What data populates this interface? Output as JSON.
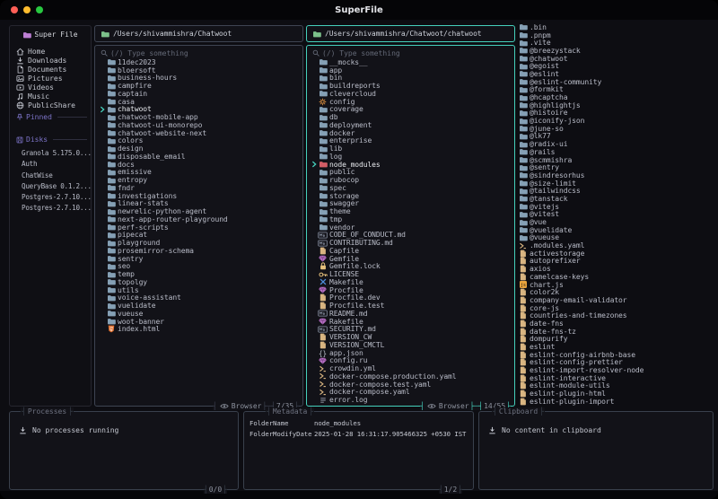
{
  "window": {
    "title": "SuperFile"
  },
  "sidebar": {
    "app_title": "Super File",
    "items": [
      {
        "label": "Home",
        "icon": "home"
      },
      {
        "label": "Downloads",
        "icon": "download"
      },
      {
        "label": "Documents",
        "icon": "document"
      },
      {
        "label": "Pictures",
        "icon": "picture"
      },
      {
        "label": "Videos",
        "icon": "video"
      },
      {
        "label": "Music",
        "icon": "music"
      },
      {
        "label": "PublicShare",
        "icon": "globe"
      }
    ],
    "pinned_label": "Pinned",
    "disks_label": "Disks",
    "disks": [
      "Granola 5.175.0...",
      "Auth",
      "ChatWise",
      "QueryBase 0.1.2...",
      "Postgres-2.7.10...",
      "Postgres-2.7.10..."
    ]
  },
  "panels": [
    {
      "path": "/Users/shivammishra/Chatwoot",
      "search_placeholder": "(/) Type something",
      "footer_mode": "Browser",
      "footer_count": "7/35",
      "active": false,
      "files": [
        {
          "name": "11dec2023",
          "icon": "folder"
        },
        {
          "name": "bloersoft",
          "icon": "folder"
        },
        {
          "name": "business-hours",
          "icon": "folder"
        },
        {
          "name": "campfire",
          "icon": "folder"
        },
        {
          "name": "captain",
          "icon": "folder"
        },
        {
          "name": "casa",
          "icon": "folder"
        },
        {
          "name": "chatwoot",
          "icon": "folder",
          "selected": true
        },
        {
          "name": "chatwoot-mobile-app",
          "icon": "folder"
        },
        {
          "name": "chatwoot-ui-monorepo",
          "icon": "folder"
        },
        {
          "name": "chatwoot-website-next",
          "icon": "folder"
        },
        {
          "name": "colors",
          "icon": "folder"
        },
        {
          "name": "design",
          "icon": "folder"
        },
        {
          "name": "disposable_email",
          "icon": "folder"
        },
        {
          "name": "docs",
          "icon": "folder"
        },
        {
          "name": "emissive",
          "icon": "folder"
        },
        {
          "name": "entropy",
          "icon": "folder"
        },
        {
          "name": "fndr",
          "icon": "folder"
        },
        {
          "name": "investigations",
          "icon": "folder"
        },
        {
          "name": "linear-stats",
          "icon": "folder"
        },
        {
          "name": "newrelic-python-agent",
          "icon": "folder"
        },
        {
          "name": "next-app-router-playground",
          "icon": "folder"
        },
        {
          "name": "perf-scripts",
          "icon": "folder"
        },
        {
          "name": "pipecat",
          "icon": "folder"
        },
        {
          "name": "playground",
          "icon": "folder"
        },
        {
          "name": "prosemirror-schema",
          "icon": "folder"
        },
        {
          "name": "sentry",
          "icon": "folder"
        },
        {
          "name": "seo",
          "icon": "folder"
        },
        {
          "name": "temp",
          "icon": "folder"
        },
        {
          "name": "topolgy",
          "icon": "folder"
        },
        {
          "name": "utils",
          "icon": "folder"
        },
        {
          "name": "voice-assistant",
          "icon": "folder"
        },
        {
          "name": "vuelidate",
          "icon": "folder"
        },
        {
          "name": "vueuse",
          "icon": "folder"
        },
        {
          "name": "woot-banner",
          "icon": "folder"
        },
        {
          "name": "index.html",
          "icon": "html"
        }
      ]
    },
    {
      "path": "/Users/shivammishra/Chatwoot/chatwoot",
      "search_placeholder": "(/) Type something",
      "footer_mode": "Browser",
      "footer_count": "14/55",
      "active": true,
      "files": [
        {
          "name": "__mocks__",
          "icon": "folder"
        },
        {
          "name": "app",
          "icon": "folder"
        },
        {
          "name": "bin",
          "icon": "folder"
        },
        {
          "name": "buildreports",
          "icon": "folder"
        },
        {
          "name": "clevercloud",
          "icon": "folder"
        },
        {
          "name": "config",
          "icon": "gear"
        },
        {
          "name": "coverage",
          "icon": "folder"
        },
        {
          "name": "db",
          "icon": "folder"
        },
        {
          "name": "deployment",
          "icon": "folder"
        },
        {
          "name": "docker",
          "icon": "folder"
        },
        {
          "name": "enterprise",
          "icon": "folder"
        },
        {
          "name": "lib",
          "icon": "folder"
        },
        {
          "name": "log",
          "icon": "folder"
        },
        {
          "name": "node_modules",
          "icon": "folder-node",
          "selected": true
        },
        {
          "name": "public",
          "icon": "folder"
        },
        {
          "name": "rubocop",
          "icon": "folder"
        },
        {
          "name": "spec",
          "icon": "folder"
        },
        {
          "name": "storage",
          "icon": "folder"
        },
        {
          "name": "swagger",
          "icon": "folder"
        },
        {
          "name": "theme",
          "icon": "folder"
        },
        {
          "name": "tmp",
          "icon": "folder"
        },
        {
          "name": "vendor",
          "icon": "folder"
        },
        {
          "name": "CODE_OF_CONDUCT.md",
          "icon": "md"
        },
        {
          "name": "CONTRIBUTING.md",
          "icon": "md"
        },
        {
          "name": "Capfile",
          "icon": "file"
        },
        {
          "name": "Gemfile",
          "icon": "gem"
        },
        {
          "name": "Gemfile.lock",
          "icon": "lock"
        },
        {
          "name": "LICENSE",
          "icon": "key"
        },
        {
          "name": "Makefile",
          "icon": "tools"
        },
        {
          "name": "Procfile",
          "icon": "gem"
        },
        {
          "name": "Procfile.dev",
          "icon": "file"
        },
        {
          "name": "Procfile.test",
          "icon": "file"
        },
        {
          "name": "README.md",
          "icon": "md"
        },
        {
          "name": "Rakefile",
          "icon": "gem"
        },
        {
          "name": "SECURITY.md",
          "icon": "md"
        },
        {
          "name": "VERSION_CW",
          "icon": "file"
        },
        {
          "name": "VERSION_CMCTL",
          "icon": "file"
        },
        {
          "name": "app.json",
          "icon": "json"
        },
        {
          "name": "config.ru",
          "icon": "gem"
        },
        {
          "name": "crowdin.yml",
          "icon": "yaml"
        },
        {
          "name": "docker-compose.production.yaml",
          "icon": "yaml"
        },
        {
          "name": "docker-compose.test.yaml",
          "icon": "yaml"
        },
        {
          "name": "docker-compose.yaml",
          "icon": "yaml"
        },
        {
          "name": "error.log",
          "icon": "log"
        }
      ]
    },
    {
      "files": [
        {
          "name": ".bin",
          "icon": "folder"
        },
        {
          "name": ".pnpm",
          "icon": "folder"
        },
        {
          "name": ".vite",
          "icon": "folder"
        },
        {
          "name": "@breezystack",
          "icon": "folder"
        },
        {
          "name": "@chatwoot",
          "icon": "folder"
        },
        {
          "name": "@egoist",
          "icon": "folder"
        },
        {
          "name": "@eslint",
          "icon": "folder"
        },
        {
          "name": "@eslint-community",
          "icon": "folder"
        },
        {
          "name": "@formkit",
          "icon": "folder"
        },
        {
          "name": "@hcaptcha",
          "icon": "folder"
        },
        {
          "name": "@highlightjs",
          "icon": "folder"
        },
        {
          "name": "@histoire",
          "icon": "folder"
        },
        {
          "name": "@iconify-json",
          "icon": "folder"
        },
        {
          "name": "@june-so",
          "icon": "folder"
        },
        {
          "name": "@lk77",
          "icon": "folder"
        },
        {
          "name": "@radix-ui",
          "icon": "folder"
        },
        {
          "name": "@rails",
          "icon": "folder"
        },
        {
          "name": "@scmmishra",
          "icon": "folder"
        },
        {
          "name": "@sentry",
          "icon": "folder"
        },
        {
          "name": "@sindresorhus",
          "icon": "folder"
        },
        {
          "name": "@size-limit",
          "icon": "folder"
        },
        {
          "name": "@tailwindcss",
          "icon": "folder"
        },
        {
          "name": "@tanstack",
          "icon": "folder"
        },
        {
          "name": "@vitejs",
          "icon": "folder"
        },
        {
          "name": "@vitest",
          "icon": "folder"
        },
        {
          "name": "@vue",
          "icon": "folder"
        },
        {
          "name": "@vuelidate",
          "icon": "folder"
        },
        {
          "name": "@vueuse",
          "icon": "folder"
        },
        {
          "name": ".modules.yaml",
          "icon": "yaml"
        },
        {
          "name": "activestorage",
          "icon": "file"
        },
        {
          "name": "autoprefixer",
          "icon": "file"
        },
        {
          "name": "axios",
          "icon": "file"
        },
        {
          "name": "camelcase-keys",
          "icon": "file"
        },
        {
          "name": "chart.js",
          "icon": "js"
        },
        {
          "name": "color2k",
          "icon": "file"
        },
        {
          "name": "company-email-validator",
          "icon": "file"
        },
        {
          "name": "core-js",
          "icon": "file"
        },
        {
          "name": "countries-and-timezones",
          "icon": "file"
        },
        {
          "name": "date-fns",
          "icon": "file"
        },
        {
          "name": "date-fns-tz",
          "icon": "file"
        },
        {
          "name": "dompurify",
          "icon": "file"
        },
        {
          "name": "eslint",
          "icon": "file"
        },
        {
          "name": "eslint-config-airbnb-base",
          "icon": "file"
        },
        {
          "name": "eslint-config-prettier",
          "icon": "file"
        },
        {
          "name": "eslint-import-resolver-node",
          "icon": "file"
        },
        {
          "name": "eslint-interactive",
          "icon": "file"
        },
        {
          "name": "eslint-module-utils",
          "icon": "file"
        },
        {
          "name": "eslint-plugin-html",
          "icon": "file"
        },
        {
          "name": "eslint-plugin-import",
          "icon": "file"
        }
      ]
    }
  ],
  "bottom": {
    "processes": {
      "title": "Processes",
      "empty_text": "No processes running",
      "count": "0/0"
    },
    "metadata": {
      "title": "Metadata",
      "rows": [
        {
          "key": "FolderName",
          "value": "node_modules"
        },
        {
          "key": "FolderModifyDate",
          "value": "2025-01-28 16:31:17.905466325 +0530 IST"
        }
      ],
      "count": "1/2"
    },
    "clipboard": {
      "title": "Clipboard",
      "empty_text": "No content in clipboard"
    }
  },
  "colors": {
    "accent_teal": "#45d0bc",
    "border_gray": "#3e4452",
    "folder_blue": "#85a0b5",
    "folder_green": "#7cc08a",
    "logo_purple": "#bd7fd4",
    "section_purple": "#7d74c9",
    "node_red": "#d25d66",
    "config_orange": "#d98e3e",
    "file_tan": "#d9b581"
  }
}
